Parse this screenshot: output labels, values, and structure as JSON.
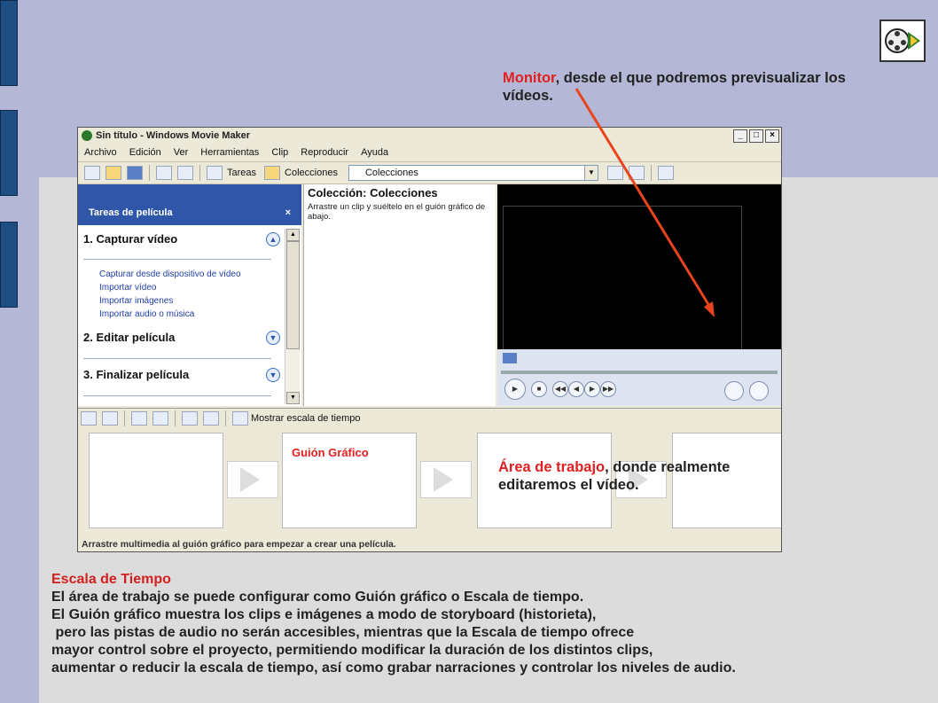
{
  "window": {
    "title": "Sin título - Windows Movie Maker",
    "menu": [
      "Archivo",
      "Edición",
      "Ver",
      "Herramientas",
      "Clip",
      "Reproducir",
      "Ayuda"
    ],
    "toolbar": {
      "tareas_label": "Tareas",
      "colecciones_label": "Colecciones",
      "combo_value": "Colecciones"
    }
  },
  "tasks": {
    "header": "Tareas de película",
    "close": "×",
    "section1": "1. Capturar vídeo",
    "links": [
      "Capturar desde dispositivo de vídeo",
      "Importar vídeo",
      "Importar imágenes",
      "Importar audio o música"
    ],
    "section2": "2. Editar película",
    "section3": "3. Finalizar película"
  },
  "collection": {
    "title": "Colección: Colecciones",
    "description": "Arrastre un clip y suéltelo en el guión gráfico de abajo."
  },
  "timeline_toolbar": {
    "show_timeline_label": "Mostrar escala de tiempo"
  },
  "storyboard": {
    "footer": "Arrastre multimedia al guión gráfico para empezar a crear una película."
  },
  "annotations": {
    "monitor_red": "Monitor",
    "monitor_line1": ", desde el que podremos previsualizar los",
    "monitor_line2": "vídeos.",
    "work_red": "Área de trabajo",
    "work_line1": ", donde realmente",
    "work_line2": "editaremos el vídeo.",
    "guion": "Guión Gráfico"
  },
  "body": {
    "title": "Escala de Tiempo",
    "lines": [
      "El área de trabajo se puede configurar como Guión gráfico o Escala de tiempo.",
      "El Guión gráfico muestra los clips e imágenes a modo de storyboard (historieta),",
      " pero las pistas de audio no serán accesibles, mientras que la Escala de tiempo ofrece",
      "mayor control sobre el proyecto, permitiendo modificar la duración de los distintos clips,",
      "aumentar o reducir la escala de tiempo, así como grabar narraciones y controlar los niveles de audio."
    ]
  },
  "colors": {
    "accent_red": "#e02020",
    "arrow": "#e8441e",
    "task_blue": "#2f56a8"
  }
}
